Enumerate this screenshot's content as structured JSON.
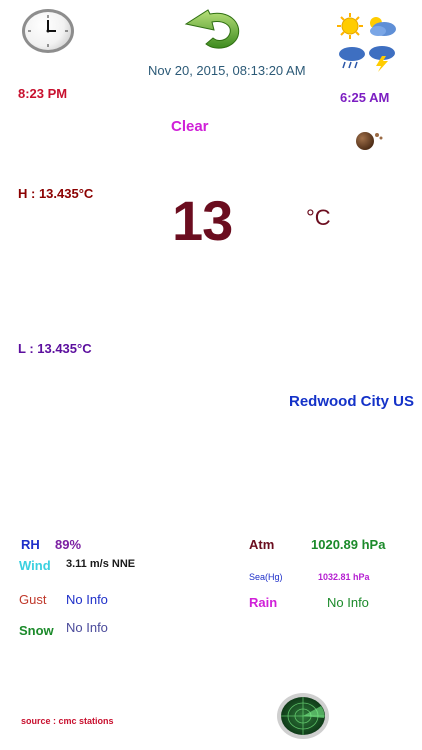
{
  "header": {
    "date_time": "Nov 20, 2015, 08:13:20 AM",
    "sunset_time": "8:23 PM",
    "sunrise_time": "6:25 AM"
  },
  "condition": {
    "text": "Clear"
  },
  "temperature": {
    "current": "13",
    "unit": "°C",
    "high": "H : 13.435°C",
    "low": "L : 13.435°C"
  },
  "location": {
    "city": "Redwood City US"
  },
  "details": {
    "rh_label": "RH",
    "rh_value": "89%",
    "wind_label": "Wind",
    "wind_value": "3.11 m/s NNE",
    "gust_label": "Gust",
    "gust_value": "No Info",
    "snow_label": "Snow",
    "snow_value": "No Info",
    "atm_label": "Atm",
    "atm_value": "1020.89 hPa",
    "sea_label": "Sea(Hg)",
    "sea_value": "1032.81 hPa",
    "rain_label": "Rain",
    "rain_value": "No Info"
  },
  "footer": {
    "source": "source : cmc stations"
  },
  "icons": {
    "clock": "clock-icon",
    "refresh": "refresh-icon",
    "weather": "weather-conditions-icon",
    "moon": "moon-phase-icon",
    "radar": "radar-icon"
  }
}
